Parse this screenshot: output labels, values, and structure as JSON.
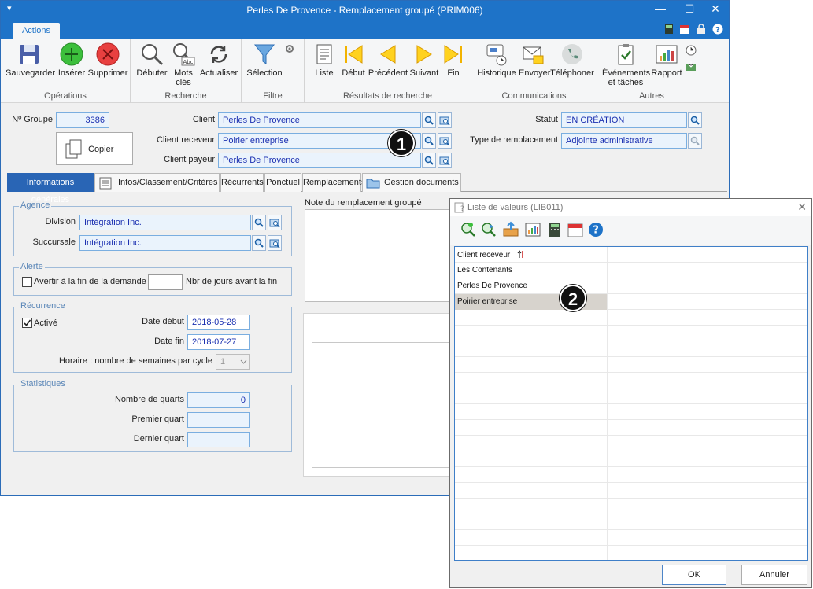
{
  "window": {
    "title": "Perles De Provence - Remplacement groupé (PRIM006)",
    "tab_actions": "Actions"
  },
  "ribbon": {
    "operations": {
      "label": "Opérations",
      "save": "Sauvegarder",
      "insert": "Insérer",
      "delete": "Supprimer"
    },
    "recherche": {
      "label": "Recherche",
      "start": "Débuter",
      "keywords_1": "Mots",
      "keywords_2": "clés",
      "refresh": "Actualiser"
    },
    "filtre": {
      "label": "Filtre",
      "selection": "Sélection"
    },
    "resultats": {
      "label": "Résultats de recherche",
      "list": "Liste",
      "first": "Début",
      "prev": "Précédent",
      "next": "Suivant",
      "last": "Fin"
    },
    "communications": {
      "label": "Communications",
      "history": "Historique",
      "send": "Envoyer",
      "phone": "Téléphoner"
    },
    "autres": {
      "label": "Autres",
      "events_1": "Événements",
      "events_2": "et tâches",
      "report": "Rapport"
    }
  },
  "form": {
    "group_no_label": "Nº Groupe",
    "group_no": "3386",
    "copy_label": "Copier",
    "client_label": "Client",
    "client": "Perles De Provence",
    "client_receveur_label": "Client receveur",
    "client_receveur": "Poirier entreprise",
    "client_payeur_label": "Client payeur",
    "client_payeur": "Perles De Provence",
    "statut_label": "Statut",
    "statut": "EN CRÉATION",
    "type_label": "Type de remplacement",
    "type": "Adjointe administrative"
  },
  "tabs": {
    "general": "Informations générales",
    "infos": "Infos/Classement/Critères",
    "recurrents": "Récurrents",
    "ponctuel": "Ponctuel",
    "remplacements": "Remplacements",
    "documents": "Gestion documents"
  },
  "agence": {
    "title": "Agence",
    "division_label": "Division",
    "division": "Intégration Inc.",
    "succursale_label": "Succursale",
    "succursale": "Intégration Inc."
  },
  "alerte": {
    "title": "Alerte",
    "checkbox_label": "Avertir à la fin de la demande",
    "days_label": "Nbr de jours avant la fin",
    "days_value": ""
  },
  "recurrence": {
    "title": "Récurrence",
    "active_label": "Activé",
    "start_label": "Date début",
    "start": "2018-05-28",
    "end_label": "Date fin",
    "end": "2018-07-27",
    "schedule_label": "Horaire : nombre de semaines par cycle",
    "schedule_value": "1"
  },
  "statistiques": {
    "title": "Statistiques",
    "shifts_label": "Nombre de quarts",
    "shifts": "0",
    "first_label": "Premier quart",
    "first": "",
    "last_label": "Dernier quart",
    "last": ""
  },
  "note": {
    "label": "Note du remplacement groupé"
  },
  "badges": {
    "b1": "1",
    "b2": "2"
  },
  "lov": {
    "title": "Liste de valeurs (LIB011)",
    "header": "Client receveur",
    "rows": [
      "Les Contenants",
      "Perles De Provence",
      "Poirier entreprise"
    ],
    "ok": "OK",
    "cancel": "Annuler"
  }
}
